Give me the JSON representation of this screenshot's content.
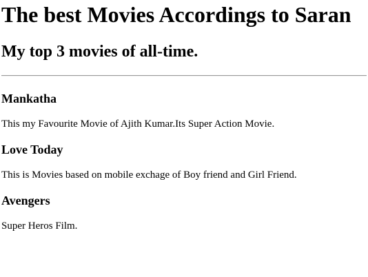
{
  "page": {
    "title": "The best Movies Accordings to Saran",
    "subtitle": "My top 3 movies of all-time."
  },
  "movies": [
    {
      "title": "Mankatha",
      "description": "This my Favourite Movie of Ajith Kumar.Its Super Action Movie."
    },
    {
      "title": "Love Today",
      "description": "This is Movies based on mobile exchage of Boy friend and Girl Friend."
    },
    {
      "title": "Avengers",
      "description": "Super Heros Film."
    }
  ],
  "colors": {
    "text": "#000000",
    "background": "#ffffff",
    "divider": "#9a9a9a"
  }
}
